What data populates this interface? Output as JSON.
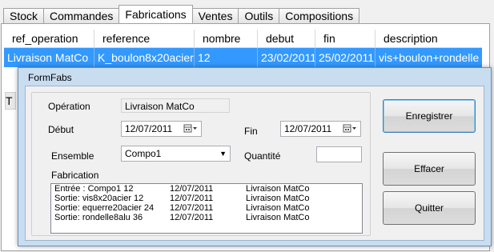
{
  "tabs": [
    "Stock",
    "Commandes",
    "Fabrications",
    "Ventes",
    "Outils",
    "Compositions"
  ],
  "active_tab": "Fabrications",
  "grid": {
    "columns": [
      "ref_operation",
      "reference",
      "nombre",
      "debut",
      "fin",
      "description"
    ],
    "rows": [
      [
        "Livraison MatCo",
        "K_boulon8x20acier",
        "12",
        "23/02/2011",
        "25/02/2011",
        "vis+boulon+rondelle"
      ]
    ],
    "row2_partial": "T"
  },
  "dialog": {
    "title": "FormFabs",
    "operation_label": "Opération",
    "operation_value": "Livraison MatCo",
    "debut_label": "Début",
    "debut_value": "12/07/2011",
    "fin_label": "Fin",
    "fin_value": "12/07/2011",
    "ensemble_label": "Ensemble",
    "ensemble_value": "Compo1",
    "quantite_label": "Quantité",
    "quantite_value": "",
    "fabrication_label": "Fabrication",
    "fabrication_lines": [
      [
        "Entrée : Compo1 12",
        "12/07/2011",
        "Livraison MatCo"
      ],
      [
        "Sortie: vis8x20acier 12",
        "12/07/2011",
        "Livraison MatCo"
      ],
      [
        "Sortie: equerre20acier 24",
        "12/07/2011",
        "Livraison MatCo"
      ],
      [
        "Sortie: rondelle8alu 36",
        "12/07/2011",
        "Livraison MatCo"
      ]
    ],
    "buttons": {
      "save": "Enregistrer",
      "clear": "Effacer",
      "quit": "Quitter"
    }
  },
  "icons": {
    "calendar": "calendar-icon",
    "dropdown": "chevron-down-icon"
  },
  "colors": {
    "selection": "#3399ff",
    "dialog_frame": "#c9ddf0"
  }
}
